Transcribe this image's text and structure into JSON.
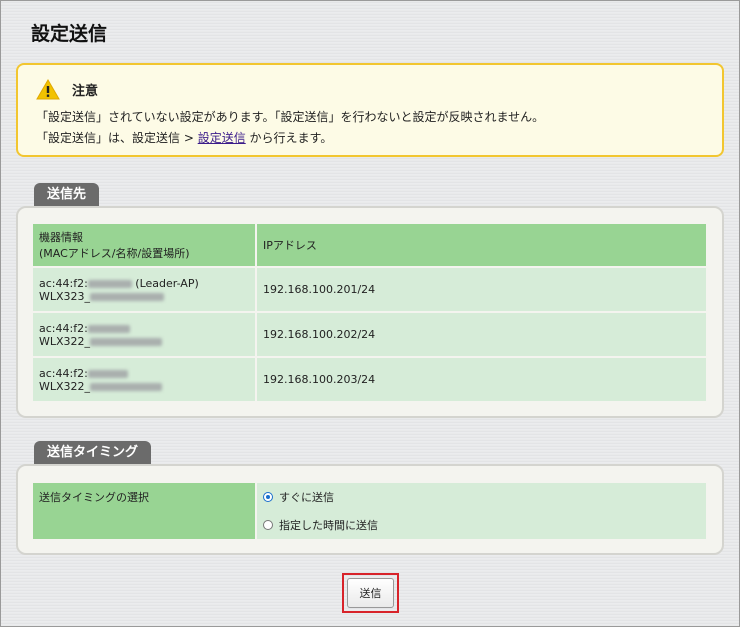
{
  "page_title": "設定送信",
  "notice": {
    "title": "注意",
    "line1": "「設定送信」されていない設定があります。「設定送信」を行わないと設定が反映されません。",
    "line2_prefix": "「設定送信」は、設定送信 > ",
    "line2_link": "設定送信",
    "line2_suffix": " から行えます。",
    "accent_color": "#f2c630"
  },
  "destination": {
    "tab_label": "送信先",
    "header_device_line1": "機器情報",
    "header_device_line2": "(MACアドレス/名称/設置場所)",
    "header_ip": "IPアドレス",
    "rows": [
      {
        "mac_prefix": "ac:44:f2:",
        "mac_suffix": " (Leader-AP)",
        "model_prefix": "WLX323_",
        "ip": "192.168.100.201/24"
      },
      {
        "mac_prefix": "ac:44:f2:",
        "mac_suffix": "",
        "model_prefix": "WLX322_",
        "ip": "192.168.100.202/24"
      },
      {
        "mac_prefix": "ac:44:f2:",
        "mac_suffix": "",
        "model_prefix": "WLX322_",
        "ip": "192.168.100.203/24"
      }
    ]
  },
  "timing": {
    "tab_label": "送信タイミング",
    "label": "送信タイミングの選択",
    "option_now": "すぐに送信",
    "option_scheduled": "指定した時間に送信",
    "selected": "すぐに送信"
  },
  "send_button": "送信",
  "colors": {
    "header_green": "#98d493",
    "row_green": "#d6ecd8",
    "highlight_red": "#d8232a"
  }
}
